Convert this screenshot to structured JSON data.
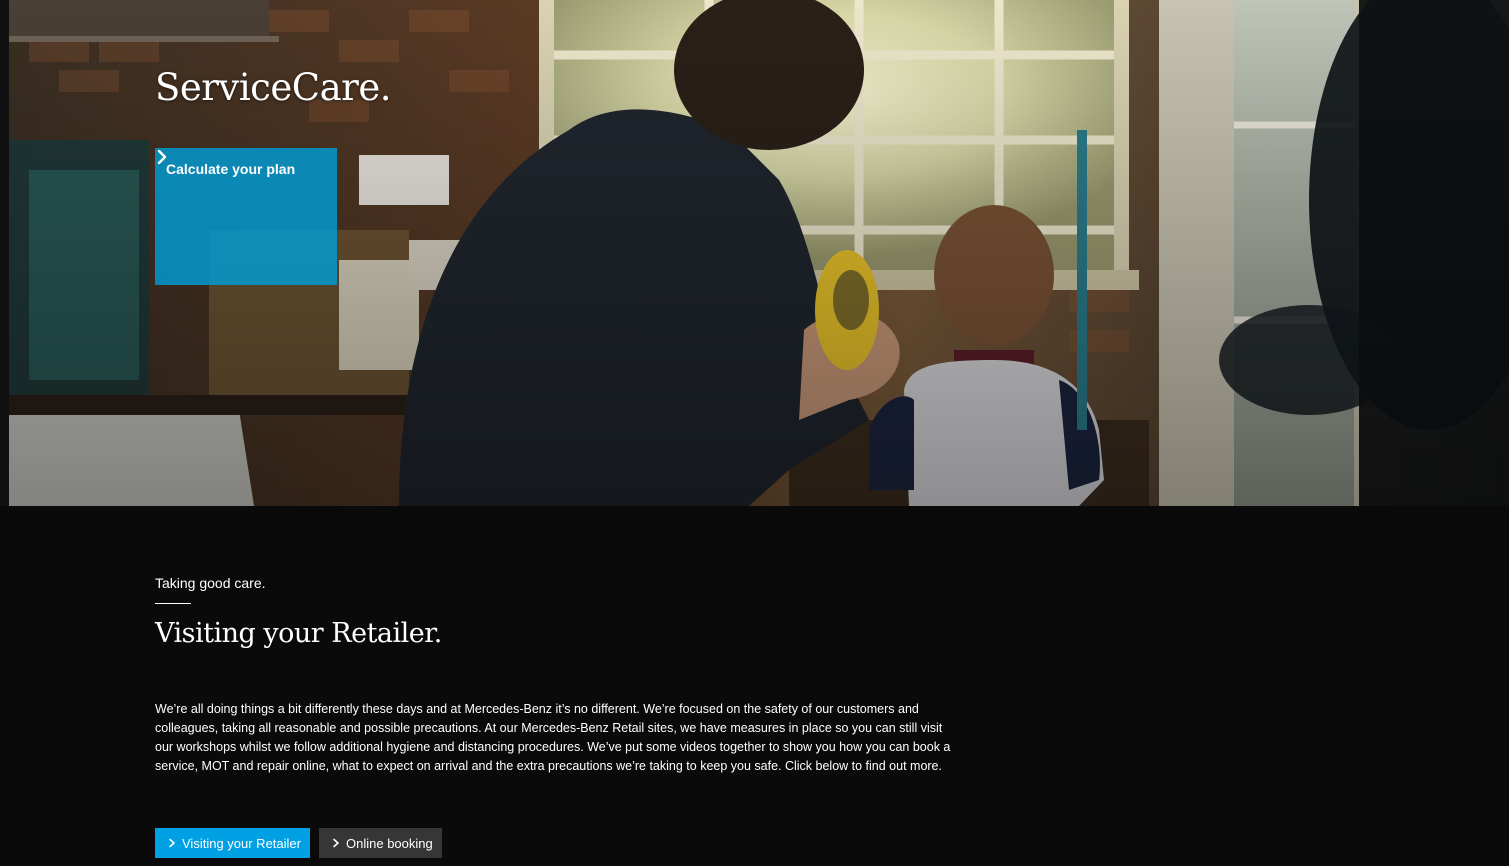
{
  "hero": {
    "title": "ServiceCare.",
    "card": {
      "label": "Calculate your plan",
      "accent_color": "#009cd6",
      "icon": "chevron-right-icon"
    },
    "background_image": "photo of father and child at workshop window holding yellow toy car"
  },
  "content": {
    "kicker": "Taking good care.",
    "title": "Visiting your Retailer.",
    "body": "We’re all doing things a bit differently these days and at Mercedes-Benz it’s no different. We’re focused on the safety of our customers and colleagues, taking all reasonable and possible precautions. At our Mercedes-Benz Retail sites, we have measures in place so you can still visit our workshops whilst we follow additional hygiene and distancing procedures. We’ve put some videos together to show you how you can book a service, MOT and repair online, what to expect on arrival and the extra precautions we’re taking to keep you safe. Click below to find out more.",
    "buttons": [
      {
        "label": "Visiting your Retailer",
        "style": "primary",
        "color": "#00a0e4",
        "icon": "chevron-right-icon"
      },
      {
        "label": "Online booking",
        "style": "secondary",
        "color": "#363636",
        "icon": "chevron-right-icon"
      }
    ]
  },
  "colors": {
    "page_background": "#0a0a0a",
    "text": "#ffffff"
  }
}
